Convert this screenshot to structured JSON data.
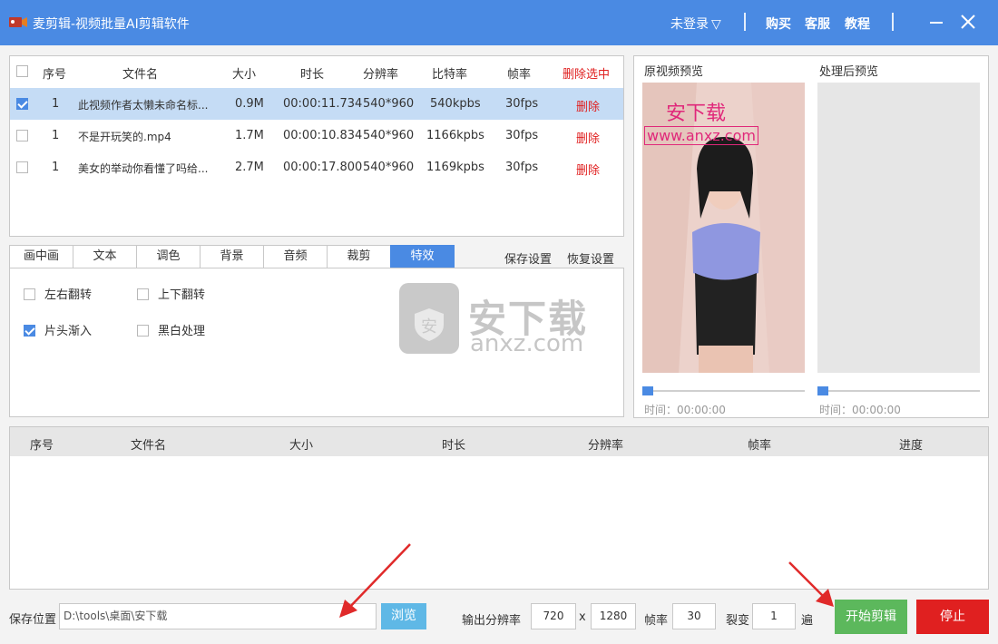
{
  "window": {
    "title": "麦剪辑-视频批量AI剪辑软件",
    "login": "未登录",
    "links": [
      "购买",
      "客服",
      "教程"
    ],
    "accent": "#4a8ae3"
  },
  "file_table": {
    "columns": [
      "序号",
      "文件名",
      "大小",
      "时长",
      "分辨率",
      "比特率",
      "帧率",
      "删除选中"
    ],
    "rows": [
      {
        "checked": true,
        "index": "1",
        "name": "此视频作者太懒未命名标...",
        "size": "0.9M",
        "duration": "00:00:11.734",
        "resolution": "540*960",
        "bitrate": "540kpbs",
        "fps": "30fps",
        "action": "删除"
      },
      {
        "checked": false,
        "index": "1",
        "name": "不是开玩笑的.mp4",
        "size": "1.7M",
        "duration": "00:00:10.834",
        "resolution": "540*960",
        "bitrate": "1166kpbs",
        "fps": "30fps",
        "action": "删除"
      },
      {
        "checked": false,
        "index": "1",
        "name": "美女的举动你看懂了吗给...",
        "size": "2.7M",
        "duration": "00:00:17.800",
        "resolution": "540*960",
        "bitrate": "1169kpbs",
        "fps": "30fps",
        "action": "删除"
      }
    ]
  },
  "tabs": {
    "items": [
      "画中画",
      "文本",
      "调色",
      "背景",
      "音频",
      "裁剪",
      "特效"
    ],
    "active": "特效",
    "save": "保存设置",
    "restore": "恢复设置"
  },
  "effects": {
    "options": [
      {
        "label": "左右翻转",
        "checked": false
      },
      {
        "label": "上下翻转",
        "checked": false
      },
      {
        "label": "片头渐入",
        "checked": true
      },
      {
        "label": "黑白处理",
        "checked": false
      }
    ]
  },
  "watermark": {
    "brand": "安下载",
    "url": "anxz.com",
    "preview_overlay_title": "安下载",
    "preview_overlay_url": "www.anxz.com"
  },
  "preview": {
    "original_label": "原视频预览",
    "processed_label": "处理后预览",
    "original_time": "时间：00:00:00",
    "processed_time": "时间：00:00:00",
    "original_progress": 0,
    "processed_progress": 0
  },
  "output_table": {
    "columns": [
      "序号",
      "文件名",
      "大小",
      "时长",
      "分辨率",
      "帧率",
      "进度"
    ]
  },
  "bottom": {
    "save_label": "保存位置",
    "save_path": "D:\\tools\\桌面\\安下载",
    "browse": "浏览",
    "resolution_label": "输出分辨率",
    "width": "720",
    "x": "x",
    "height": "1280",
    "fps_label": "帧率",
    "fps": "30",
    "split_label": "裂变",
    "split": "1",
    "times": "遍",
    "start": "开始剪辑",
    "stop": "停止"
  }
}
